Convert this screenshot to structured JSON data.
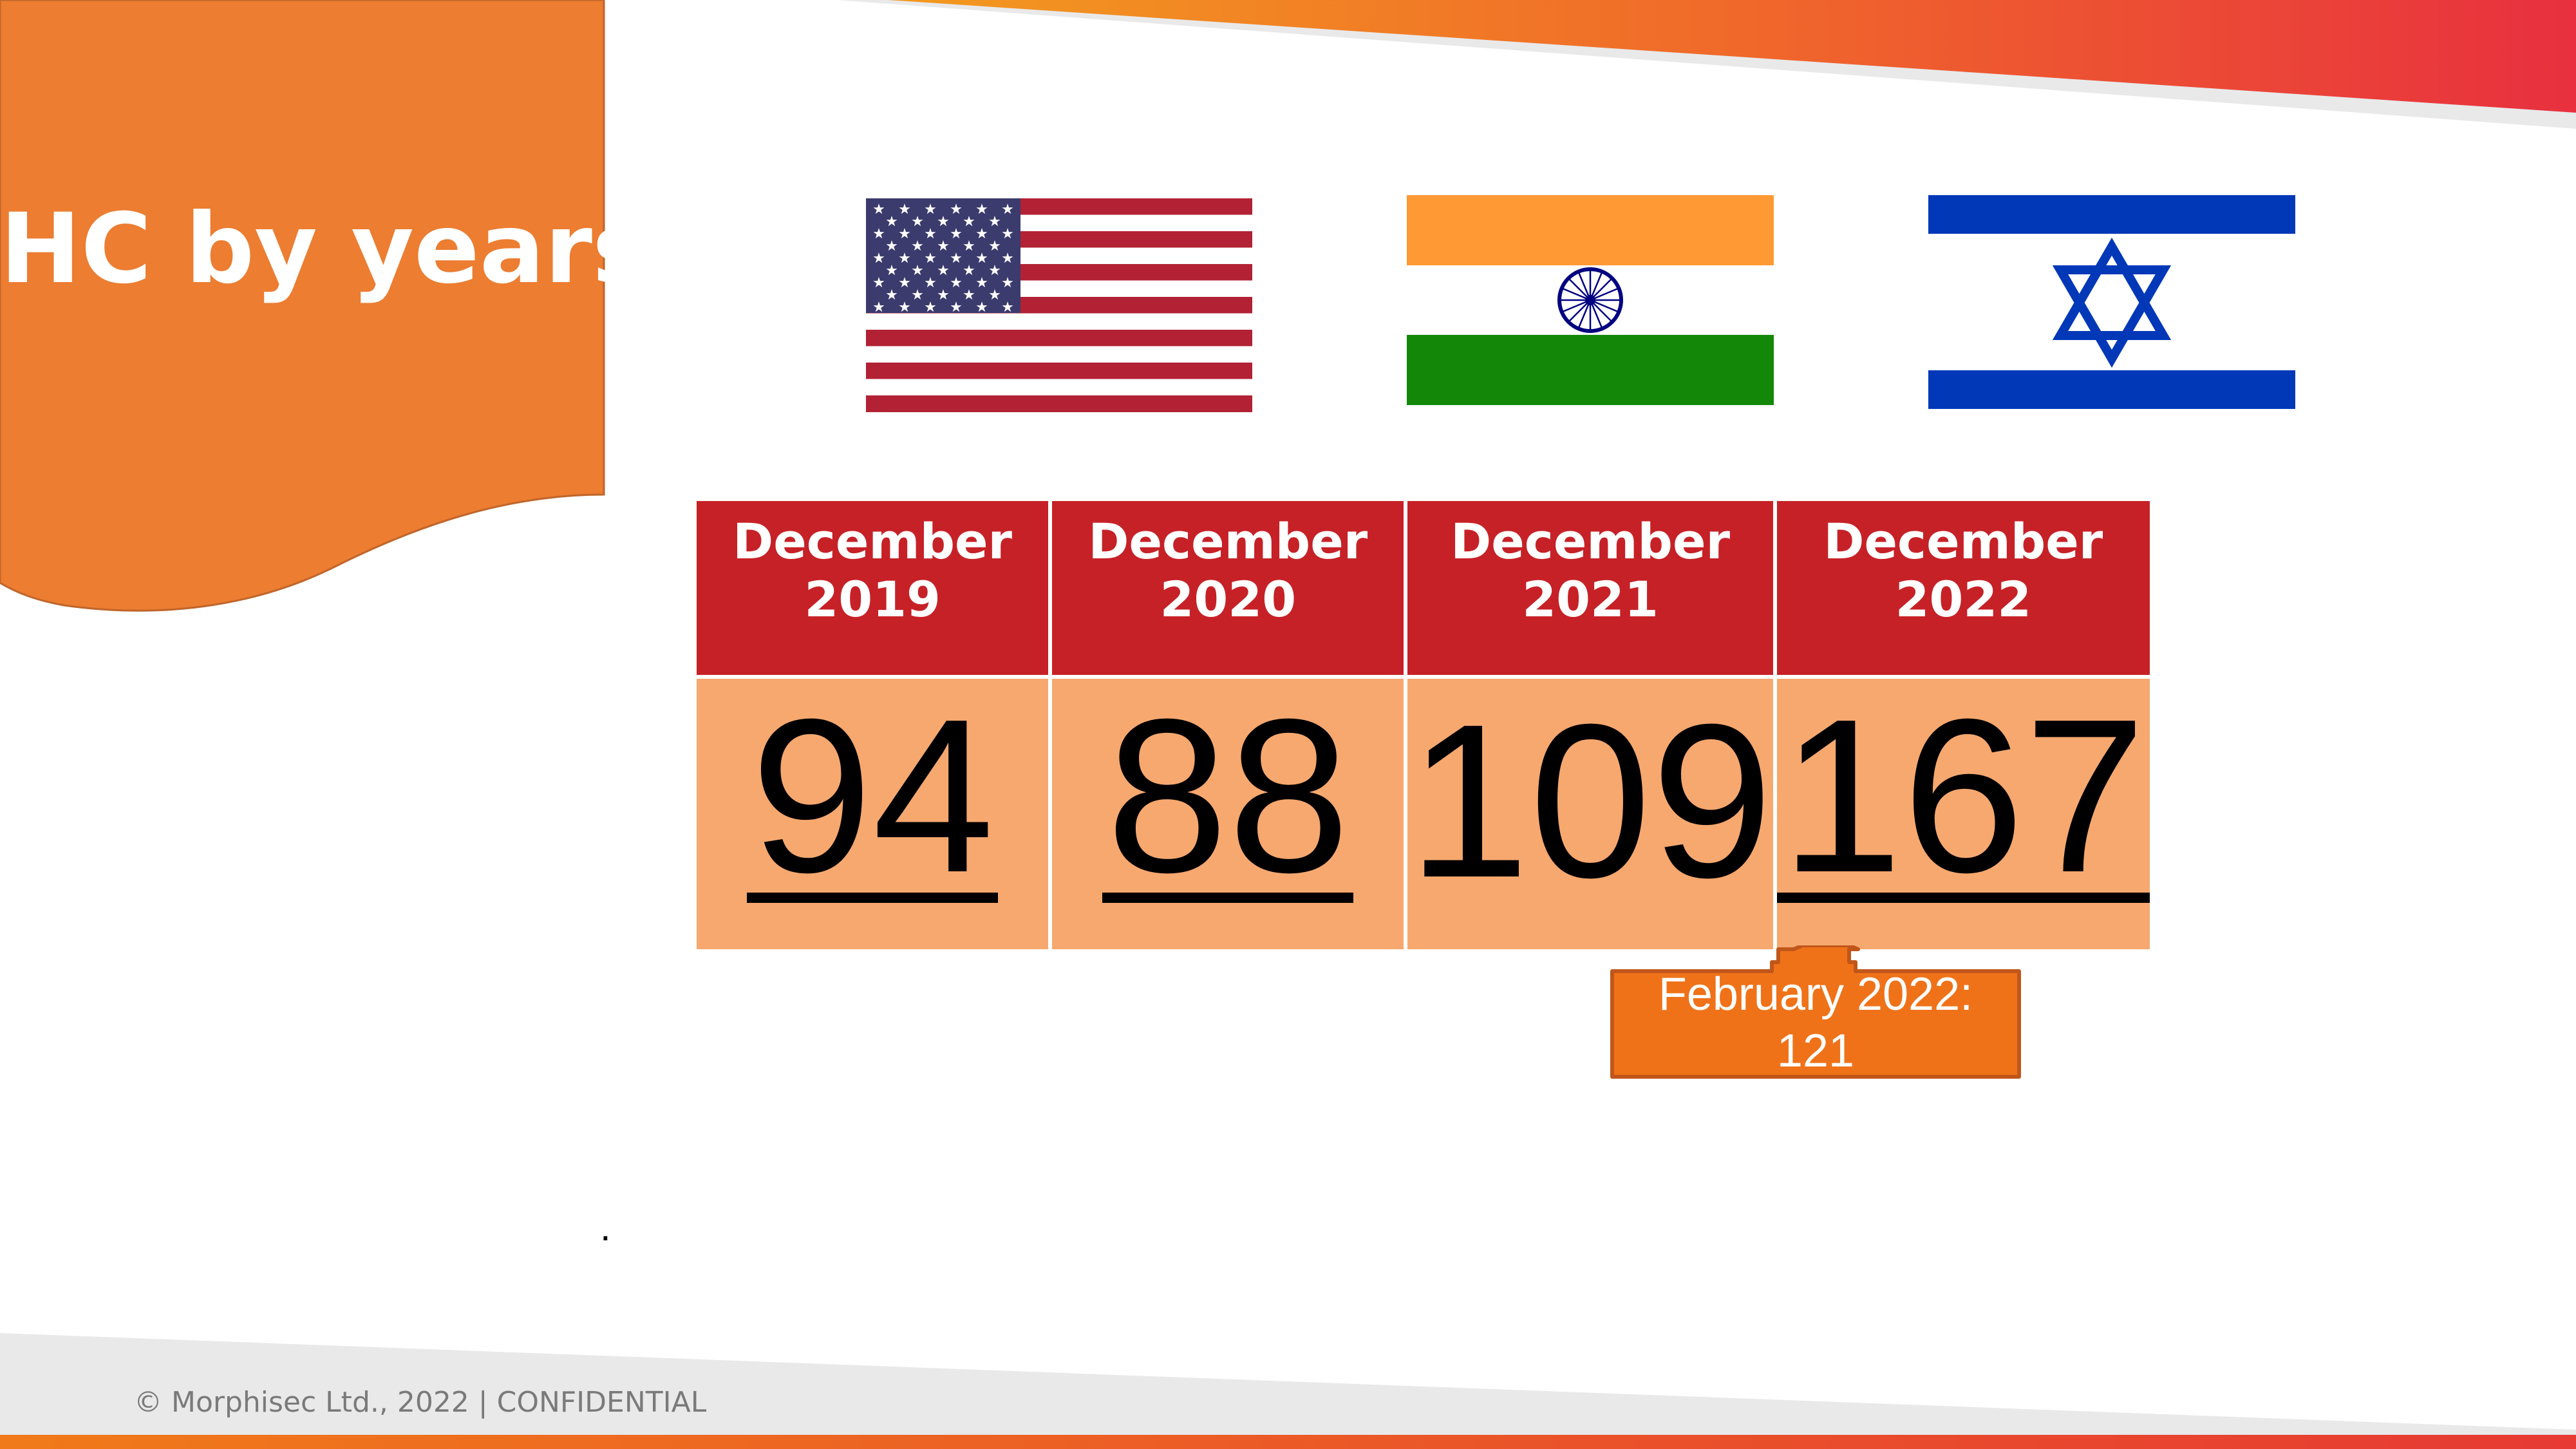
{
  "slide": {
    "title": "HC by years",
    "footer": "© Morphisec Ltd., 2022 | CONFIDENTIAL",
    "dot": "."
  },
  "flags": [
    {
      "country": "United States",
      "icon": "us-flag-icon"
    },
    {
      "country": "India",
      "icon": "india-flag-icon"
    },
    {
      "country": "Israel",
      "icon": "israel-flag-icon"
    }
  ],
  "table": {
    "columns": [
      {
        "line1": "December",
        "line2": "2019",
        "value": "94"
      },
      {
        "line1": "December",
        "line2": "2020",
        "value": "88"
      },
      {
        "line1": "December",
        "line2": "2021",
        "value": "109"
      },
      {
        "line1": "December",
        "line2": "2022",
        "value": "167"
      }
    ]
  },
  "callout": {
    "line1": "February 2022:",
    "line2": "121"
  },
  "colors": {
    "accent_orange": "#ec7d31",
    "header_red": "#c62127",
    "cell_orange": "#f6a86f",
    "callout_orange": "#ef7219"
  }
}
